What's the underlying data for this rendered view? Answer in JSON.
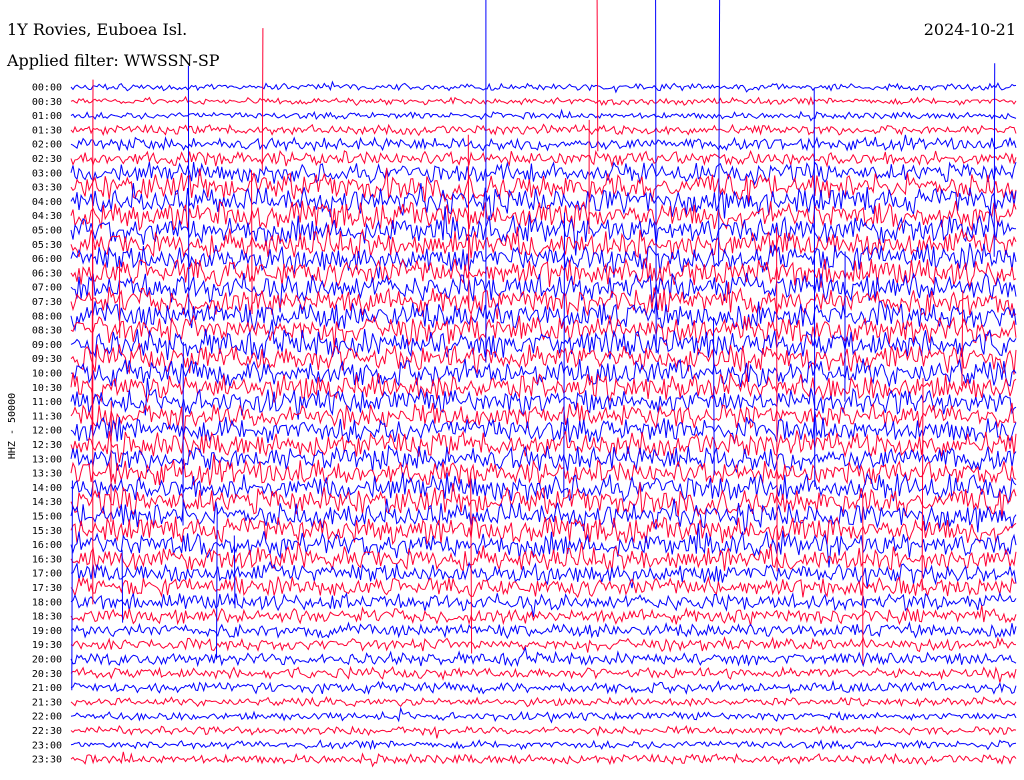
{
  "header": {
    "station": "1Y Rovies, Euboea Isl.",
    "date": "2024-10-21",
    "filter": "Applied filter: WWSSN-SP"
  },
  "chart_data": {
    "type": "line",
    "ylabel": "HHZ - 50000",
    "colors": [
      "#0000ff",
      "#ff0033"
    ],
    "row_labels": [
      "00:00",
      "00:30",
      "01:00",
      "01:30",
      "02:00",
      "02:30",
      "03:00",
      "03:30",
      "04:00",
      "04:30",
      "05:00",
      "05:30",
      "06:00",
      "06:30",
      "07:00",
      "07:30",
      "08:00",
      "08:30",
      "09:00",
      "09:30",
      "10:00",
      "10:30",
      "11:00",
      "11:30",
      "12:00",
      "12:30",
      "13:00",
      "13:30",
      "14:00",
      "14:30",
      "15:00",
      "15:30",
      "16:00",
      "16:30",
      "17:00",
      "17:30",
      "18:00",
      "18:30",
      "19:00",
      "19:30",
      "20:00",
      "20:30",
      "21:00",
      "21:30",
      "22:00",
      "22:30",
      "23:00",
      "23:30"
    ],
    "x_range_minutes": [
      0,
      30
    ],
    "noise_amplitude": [
      0.25,
      0.25,
      0.25,
      0.35,
      0.45,
      0.55,
      0.7,
      0.95,
      1.0,
      1.0,
      1.0,
      1.0,
      1.0,
      1.0,
      1.0,
      1.0,
      1.0,
      1.0,
      1.0,
      1.0,
      0.95,
      0.95,
      0.9,
      0.9,
      0.9,
      0.9,
      0.9,
      0.9,
      0.95,
      0.95,
      0.95,
      0.95,
      0.9,
      0.85,
      0.75,
      0.7,
      0.6,
      0.55,
      0.5,
      0.45,
      0.45,
      0.4,
      0.4,
      0.3,
      0.3,
      0.3,
      0.3,
      0.35
    ]
  }
}
